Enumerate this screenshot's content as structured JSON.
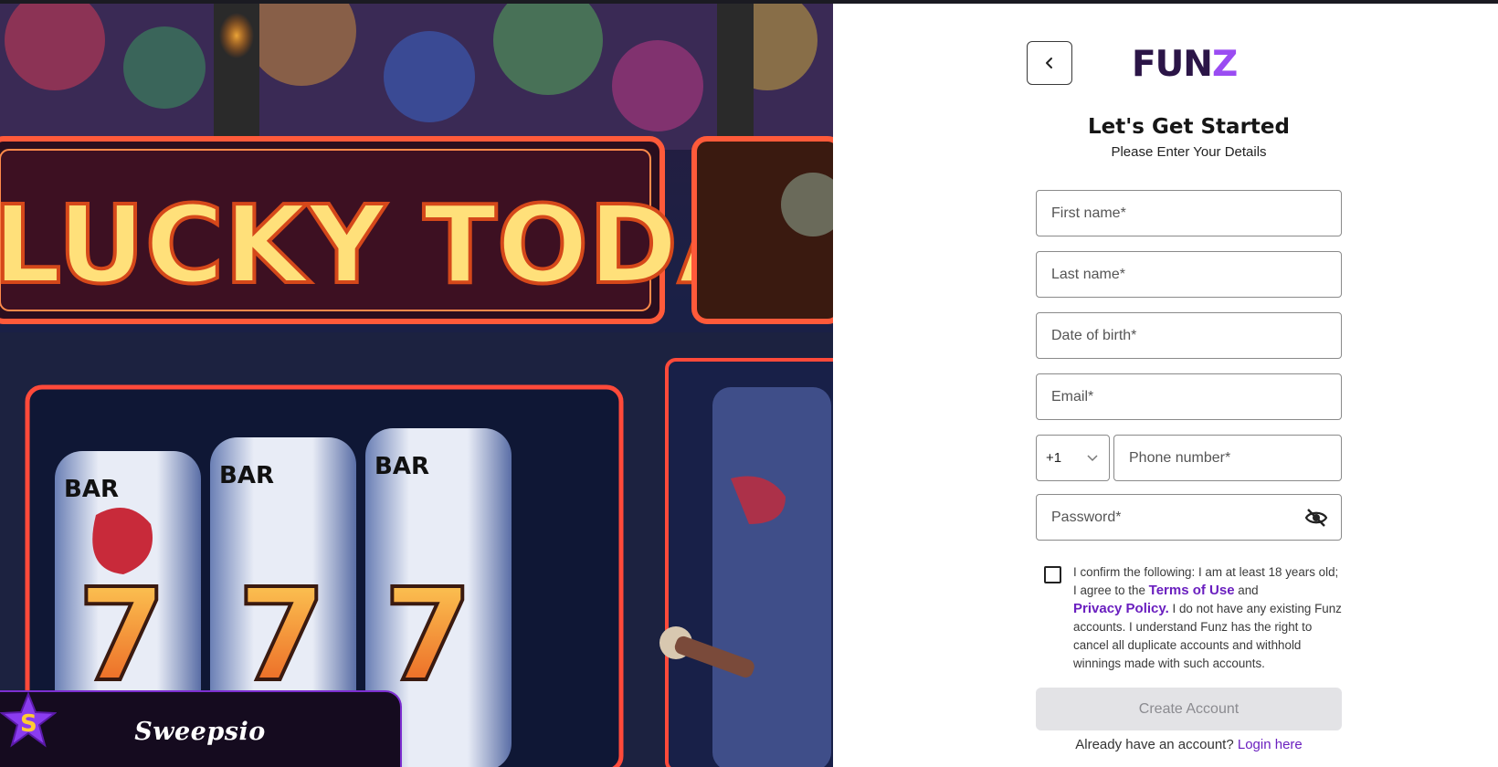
{
  "hero": {
    "sign_text": "LUCKY TODAY",
    "reel_labels": [
      "BAR",
      "BAR",
      "BAR"
    ],
    "reel_numbers": [
      "7",
      "7",
      "7"
    ],
    "badge": {
      "brand": "Sweepsio",
      "icon": "star-icon"
    }
  },
  "header": {
    "back_icon": "chevron-left-icon",
    "logo_main": "FUN",
    "logo_accent": "Z"
  },
  "form": {
    "title": "Let's Get Started",
    "subtitle": "Please Enter Your Details",
    "first_name_placeholder": "First name*",
    "last_name_placeholder": "Last name*",
    "dob_placeholder": "Date of birth*",
    "email_placeholder": "Email*",
    "country_code": "+1",
    "phone_placeholder": "Phone number*",
    "password_placeholder": "Password*",
    "password_toggle_icon": "eye-off-icon",
    "consent": {
      "part1": "I confirm the following: I am at least 18 years old; I agree to the ",
      "terms": "Terms of Use",
      "part2": " and ",
      "privacy": "Privacy Policy.",
      "part3": " I do not have any existing Funz accounts. I understand Funz has the right to cancel all duplicate accounts and withhold winnings made with such accounts."
    },
    "create_button": "Create Account",
    "already_text": "Already have an account?",
    "login_link": "Login here"
  },
  "colors": {
    "accent": "#6a1fbf",
    "logo_dark": "#2b1547",
    "logo_purple": "#9a4cf2",
    "disabled_button": "#e3e3e6"
  }
}
